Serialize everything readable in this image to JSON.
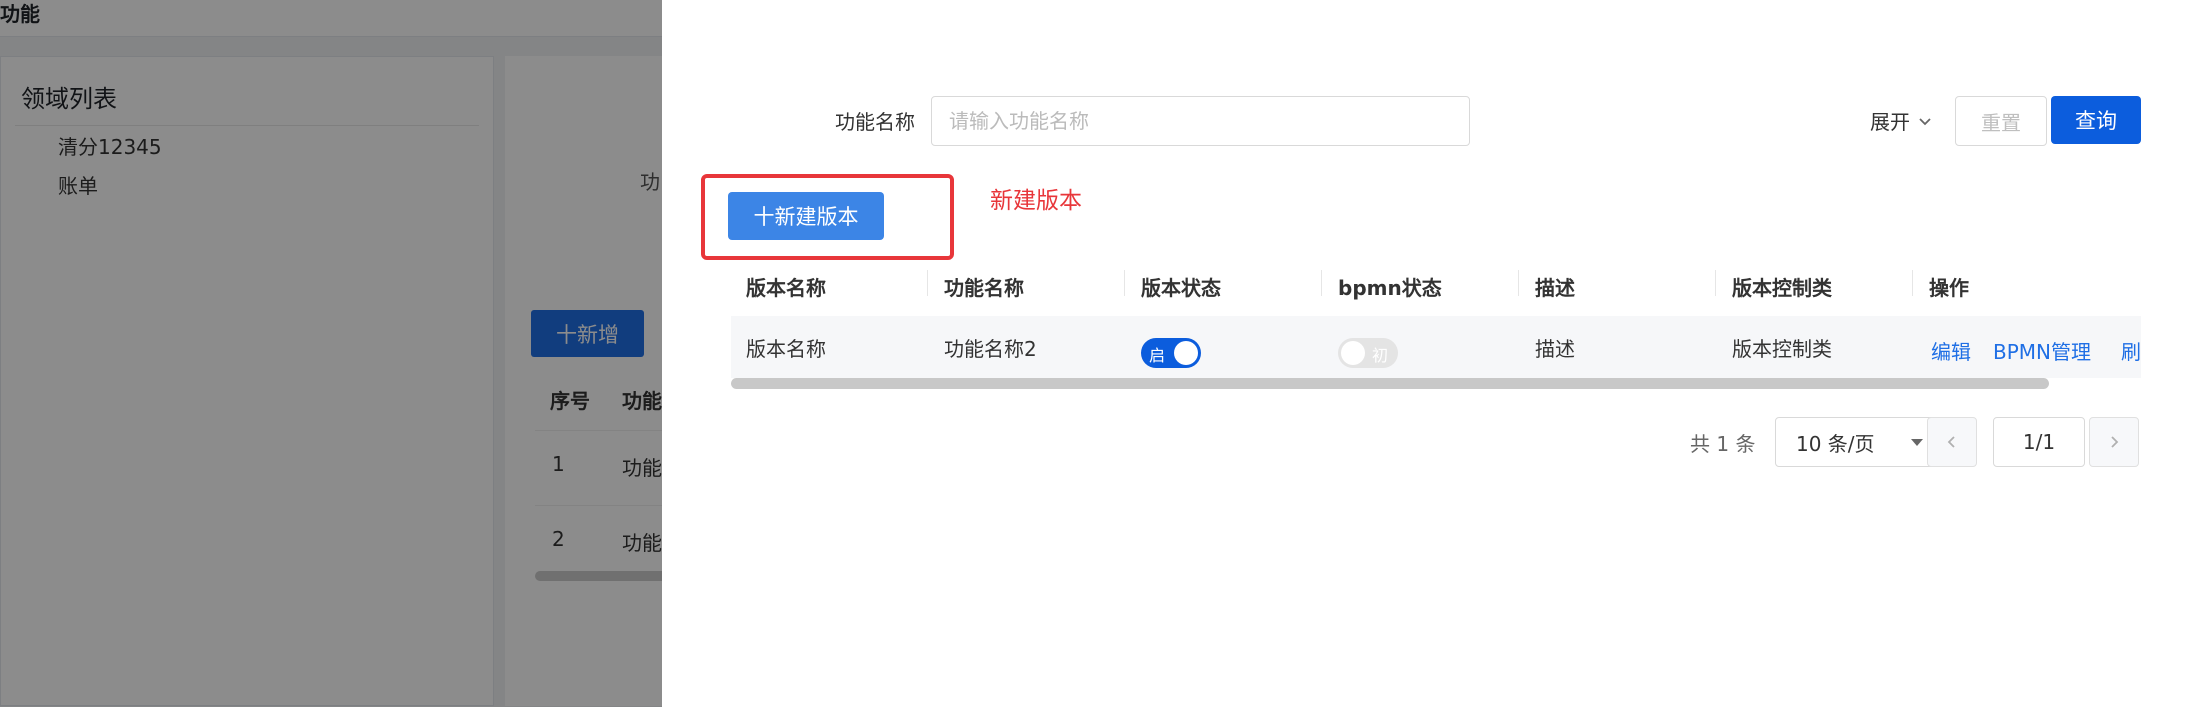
{
  "background": {
    "title": "功能",
    "domain_list_title": "领域列表",
    "tree_items": [
      "清分12345",
      "账单"
    ],
    "function_label": "功",
    "add_button": "十新增",
    "table_headers": [
      "序号",
      "功能"
    ],
    "rows": [
      {
        "index": "1",
        "name": "功能"
      },
      {
        "index": "2",
        "name": "功能"
      }
    ]
  },
  "search": {
    "label": "功能名称",
    "placeholder": "请输入功能名称",
    "value": ""
  },
  "toolbar": {
    "expand_label": "展开",
    "reset_label": "重置",
    "query_label": "查询"
  },
  "new_version": {
    "button_label": "十新建版本",
    "annotation": "新建版本"
  },
  "table": {
    "headers": [
      "版本名称",
      "功能名称",
      "版本状态",
      "bpmn状态",
      "描述",
      "版本控制类",
      "操作"
    ],
    "rows": [
      {
        "version_name": "版本名称",
        "function_name": "功能名称2",
        "version_status": "启",
        "bpmn_status": "初",
        "description": "描述",
        "control_class": "版本控制类",
        "actions": [
          "编辑",
          "BPMN管理",
          "刷"
        ]
      }
    ]
  },
  "pagination": {
    "total": "共 1 条",
    "page_size": "10 条/页",
    "page": "1/1"
  },
  "colors": {
    "primary": "#0c5ddd",
    "annotation": "#e8363a",
    "link": "#1f6fe5"
  }
}
